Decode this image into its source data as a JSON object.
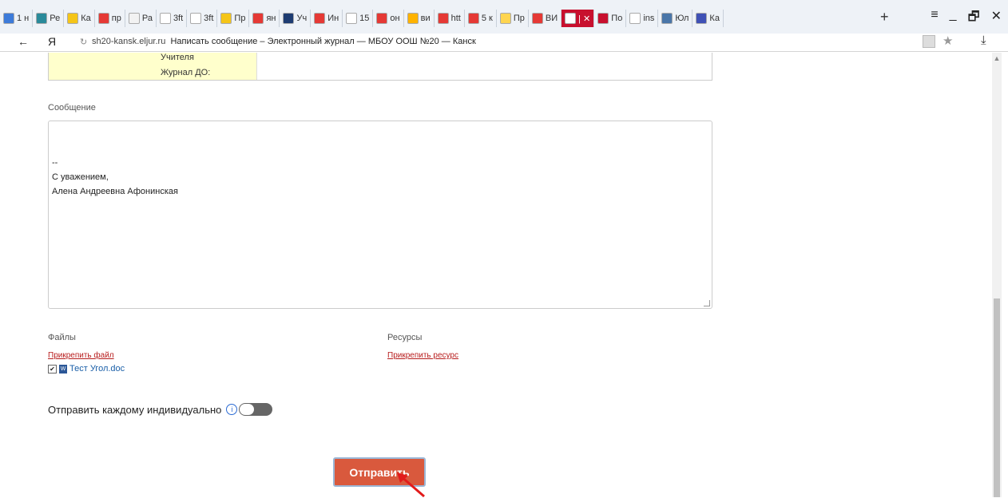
{
  "browser": {
    "tabs": [
      {
        "label": "1 н",
        "color": "#3d7bd9"
      },
      {
        "label": "Ре",
        "color": "#2a8a9a"
      },
      {
        "label": "Ка",
        "color": "#f5c518"
      },
      {
        "label": "пр",
        "color": "#e53935"
      },
      {
        "label": "Ра",
        "color": "#f2f2f2"
      },
      {
        "label": "3ft",
        "color": "#ffffff"
      },
      {
        "label": "3ft",
        "color": "#ffffff"
      },
      {
        "label": "Пр",
        "color": "#f5c518"
      },
      {
        "label": "ян",
        "color": "#e53935"
      },
      {
        "label": "Уч",
        "color": "#1e3c72"
      },
      {
        "label": "Ин",
        "color": "#e53935"
      },
      {
        "label": "15",
        "color": "#ffffff"
      },
      {
        "label": "он",
        "color": "#e53935"
      },
      {
        "label": "ви",
        "color": "#ffb300"
      },
      {
        "label": "htt",
        "color": "#e53935"
      },
      {
        "label": "5 к",
        "color": "#e53935"
      },
      {
        "label": "Пр",
        "color": "#ffd54f"
      },
      {
        "label": "ВИ",
        "color": "#e53935"
      },
      {
        "label": "| ✕",
        "color": "#ffffff",
        "active": true
      },
      {
        "label": "По",
        "color": "#c8102e"
      },
      {
        "label": "ins",
        "color": "#ffffff"
      },
      {
        "label": "Юл",
        "color": "#4a76a8"
      },
      {
        "label": "Ка",
        "color": "#3f51b5"
      }
    ],
    "new_tab": "+",
    "window_controls": [
      "≡",
      "_",
      "🗗",
      "✕"
    ],
    "address": {
      "host": "sh20-kansk.eljur.ru",
      "title": "Написать сообщение – Электронный журнал — МБОУ ООШ №20 — Канск"
    }
  },
  "recipients": {
    "line1": "Учителя",
    "line2": "Журнал ДО:"
  },
  "message": {
    "label": "Сообщение",
    "body": [
      "--",
      "С уважением,",
      "Алена Андреевна Афонинская"
    ]
  },
  "files": {
    "label": "Файлы",
    "attach_link": "Прикрепить файл",
    "items": [
      {
        "name": "Тест Угол.doc",
        "checked": true
      }
    ]
  },
  "resources": {
    "label": "Ресурсы",
    "attach_link": "Прикрепить ресурс"
  },
  "individual": {
    "label": "Отправить каждому индивидуально",
    "info_icon": "ⓘ",
    "enabled": false
  },
  "send_button": "Отправить",
  "colors": {
    "send_bg": "#d9593d",
    "link": "#b71c1c",
    "arrow": "#e21b1b"
  }
}
